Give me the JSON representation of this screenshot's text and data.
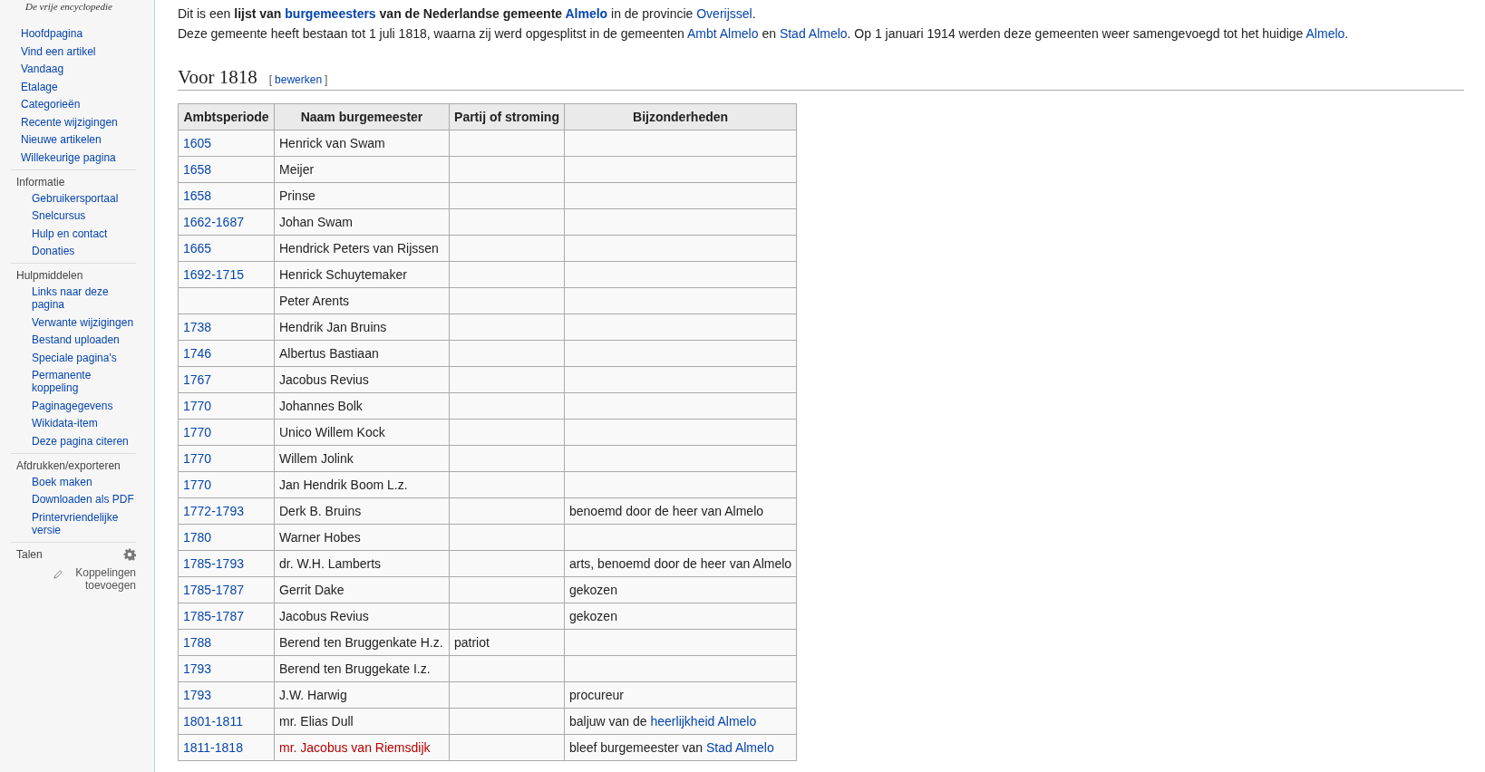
{
  "sidebar": {
    "tagline": "De vrije encyclopedie",
    "navigation": [
      "Hoofdpagina",
      "Vind een artikel",
      "Vandaag",
      "Etalage",
      "Categorieën",
      "Recente wijzigingen",
      "Nieuwe artikelen",
      "Willekeurige pagina"
    ],
    "portals": [
      {
        "heading": "Informatie",
        "items": [
          "Gebruikersportaal",
          "Snelcursus",
          "Hulp en contact",
          "Donaties"
        ]
      },
      {
        "heading": "Hulpmiddelen",
        "items": [
          "Links naar deze pagina",
          "Verwante wijzigingen",
          "Bestand uploaden",
          "Speciale pagina's",
          "Permanente koppeling",
          "Paginagegevens",
          "Wikidata-item",
          "Deze pagina citeren"
        ]
      },
      {
        "heading": "Afdrukken/exporteren",
        "items": [
          "Boek maken",
          "Downloaden als PDF",
          "Printervriendelijke versie"
        ]
      }
    ],
    "languages": {
      "heading": "Talen",
      "add_links": "Koppelingen toevoegen"
    }
  },
  "intro": [
    [
      {
        "text": "Dit is een ",
        "kind": "plain"
      },
      {
        "text": "lijst van ",
        "kind": "bold"
      },
      {
        "text": "burgemeesters",
        "kind": "bold-link"
      },
      {
        "text": " van de Nederlandse gemeente ",
        "kind": "bold"
      },
      {
        "text": "Almelo",
        "kind": "bold-link"
      },
      {
        "text": " in de provincie ",
        "kind": "plain"
      },
      {
        "text": "Overijssel",
        "kind": "link"
      },
      {
        "text": ".",
        "kind": "plain"
      }
    ],
    [
      {
        "text": "Deze gemeente heeft bestaan tot 1 juli 1818, waarna zij werd opgesplitst in de gemeenten ",
        "kind": "plain"
      },
      {
        "text": "Ambt Almelo",
        "kind": "link"
      },
      {
        "text": " en ",
        "kind": "plain"
      },
      {
        "text": "Stad Almelo",
        "kind": "link"
      },
      {
        "text": ". Op 1 januari 1914 werden deze gemeenten weer samengevoegd tot het huidige ",
        "kind": "plain"
      },
      {
        "text": "Almelo",
        "kind": "link"
      },
      {
        "text": ".",
        "kind": "plain"
      }
    ]
  ],
  "section": {
    "title": "Voor 1818",
    "open_bracket": "[",
    "edit_link": "bewerken",
    "close_bracket": "]"
  },
  "table": {
    "columns": [
      "Ambtsperiode",
      "Naam burgemeester",
      "Partij of stroming",
      "Bijzonderheden"
    ],
    "rows": [
      {
        "period": "1605",
        "name": {
          "text": "Henrick van Swam",
          "kind": "plain"
        }
      },
      {
        "period": "1658",
        "name": {
          "text": "Meijer",
          "kind": "plain"
        }
      },
      {
        "period": "1658",
        "name": {
          "text": "Prinse",
          "kind": "plain"
        }
      },
      {
        "period": "1662-1687",
        "name": {
          "text": "Johan Swam",
          "kind": "plain"
        }
      },
      {
        "period": "1665",
        "name": {
          "text": "Hendrick Peters van Rijssen",
          "kind": "plain"
        }
      },
      {
        "period": "1692-1715",
        "name": {
          "text": "Henrick Schuytemaker",
          "kind": "plain"
        }
      },
      {
        "name": {
          "text": "Peter Arents",
          "kind": "plain"
        }
      },
      {
        "period": "1738",
        "name": {
          "text": "Hendrik Jan Bruins",
          "kind": "plain"
        }
      },
      {
        "period": "1746",
        "name": {
          "text": "Albertus Bastiaan",
          "kind": "plain"
        }
      },
      {
        "period": "1767",
        "name": {
          "text": "Jacobus Revius",
          "kind": "plain"
        }
      },
      {
        "period": "1770",
        "name": {
          "text": "Johannes Bolk",
          "kind": "plain"
        }
      },
      {
        "period": "1770",
        "name": {
          "text": "Unico Willem Kock",
          "kind": "plain"
        }
      },
      {
        "period": "1770",
        "name": {
          "text": "Willem Jolink",
          "kind": "plain"
        }
      },
      {
        "period": "1770",
        "name": {
          "text": "Jan Hendrik Boom L.z.",
          "kind": "plain"
        }
      },
      {
        "period": "1772-1793",
        "name": {
          "text": "Derk B. Bruins",
          "kind": "plain"
        },
        "details": [
          {
            "text": "benoemd door de heer van Almelo",
            "kind": "plain"
          }
        ]
      },
      {
        "period": "1780",
        "name": {
          "text": "Warner Hobes",
          "kind": "plain"
        }
      },
      {
        "period": "1785-1793",
        "name": {
          "text": "dr. W.H. Lamberts",
          "kind": "plain"
        },
        "details": [
          {
            "text": "arts, benoemd door de heer van Almelo",
            "kind": "plain"
          }
        ]
      },
      {
        "period": "1785-1787",
        "name": {
          "text": "Gerrit Dake",
          "kind": "plain"
        },
        "details": [
          {
            "text": "gekozen",
            "kind": "plain"
          }
        ]
      },
      {
        "period": "1785-1787",
        "name": {
          "text": "Jacobus Revius",
          "kind": "plain"
        },
        "details": [
          {
            "text": "gekozen",
            "kind": "plain"
          }
        ]
      },
      {
        "period": "1788",
        "name": {
          "text": "Berend ten Bruggenkate H.z.",
          "kind": "plain"
        },
        "party": "patriot"
      },
      {
        "period": "1793",
        "name": {
          "text": "Berend ten Bruggekate I.z.",
          "kind": "plain"
        }
      },
      {
        "period": "1793",
        "name": {
          "text": "J.W. Harwig",
          "kind": "plain"
        },
        "details": [
          {
            "text": "procureur",
            "kind": "plain"
          }
        ]
      },
      {
        "period": "1801-1811",
        "name": {
          "text": "mr. Elias Dull",
          "kind": "plain"
        },
        "details": [
          {
            "text": "baljuw van de ",
            "kind": "plain"
          },
          {
            "text": "heerlijkheid Almelo",
            "kind": "link"
          }
        ]
      },
      {
        "period": "1811-1818",
        "name": {
          "text": "mr. Jacobus van Riemsdijk",
          "kind": "missing-link"
        },
        "details": [
          {
            "text": "bleef burgemeester van ",
            "kind": "plain"
          },
          {
            "text": "Stad Almelo",
            "kind": "link"
          }
        ]
      }
    ]
  }
}
